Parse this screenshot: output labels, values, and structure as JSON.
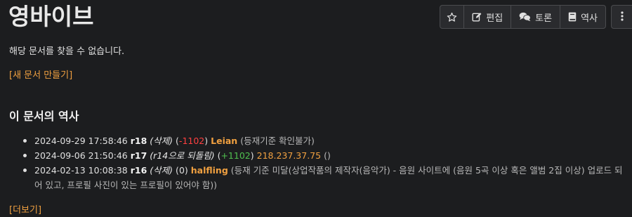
{
  "page": {
    "title": "영바이브",
    "not_found_text": "해당 문서를 찾을 수 없습니다.",
    "create_link": "[새 문서 만들기]"
  },
  "toolbar": {
    "star_icon": "star-icon",
    "edit_label": "편집",
    "discuss_label": "토론",
    "history_label": "역사",
    "menu_icon": "vertical-dots-icon"
  },
  "history": {
    "heading": "이 문서의 역사",
    "more_link": "[더보기]",
    "entries": [
      {
        "datetime": "2024-09-29 17:58:46",
        "revision": "r18",
        "action": "(삭제)",
        "diff_open": "(",
        "diff": "-1102",
        "diff_close": ")",
        "user": "Leian",
        "comment": "(등재기준 확인불가)"
      },
      {
        "datetime": "2024-09-06 21:50:46",
        "revision": "r17",
        "action": "(r14으로 되돌림)",
        "diff_open": "(",
        "diff": "+1102",
        "diff_close": ")",
        "user": "218.237.37.75",
        "comment": "()"
      },
      {
        "datetime": "2024-02-13 10:08:38",
        "revision": "r16",
        "action": "(삭제)",
        "diff_open": "(",
        "diff": "0",
        "diff_close": ")",
        "user": "halfling",
        "comment": "(등재 기준 미달(상업작품의 제작자(음악가) - 음원 사이트에 (음원 5곡 이상 혹은 앨범 2집 이상) 업로드 되어 있고, 프로필 사진이 있는 프로필이 있어야 함))"
      }
    ]
  },
  "colors": {
    "background": "#1c1d1f",
    "link": "#f0a040",
    "negative": "#ff4040",
    "positive": "#4fc04f"
  }
}
